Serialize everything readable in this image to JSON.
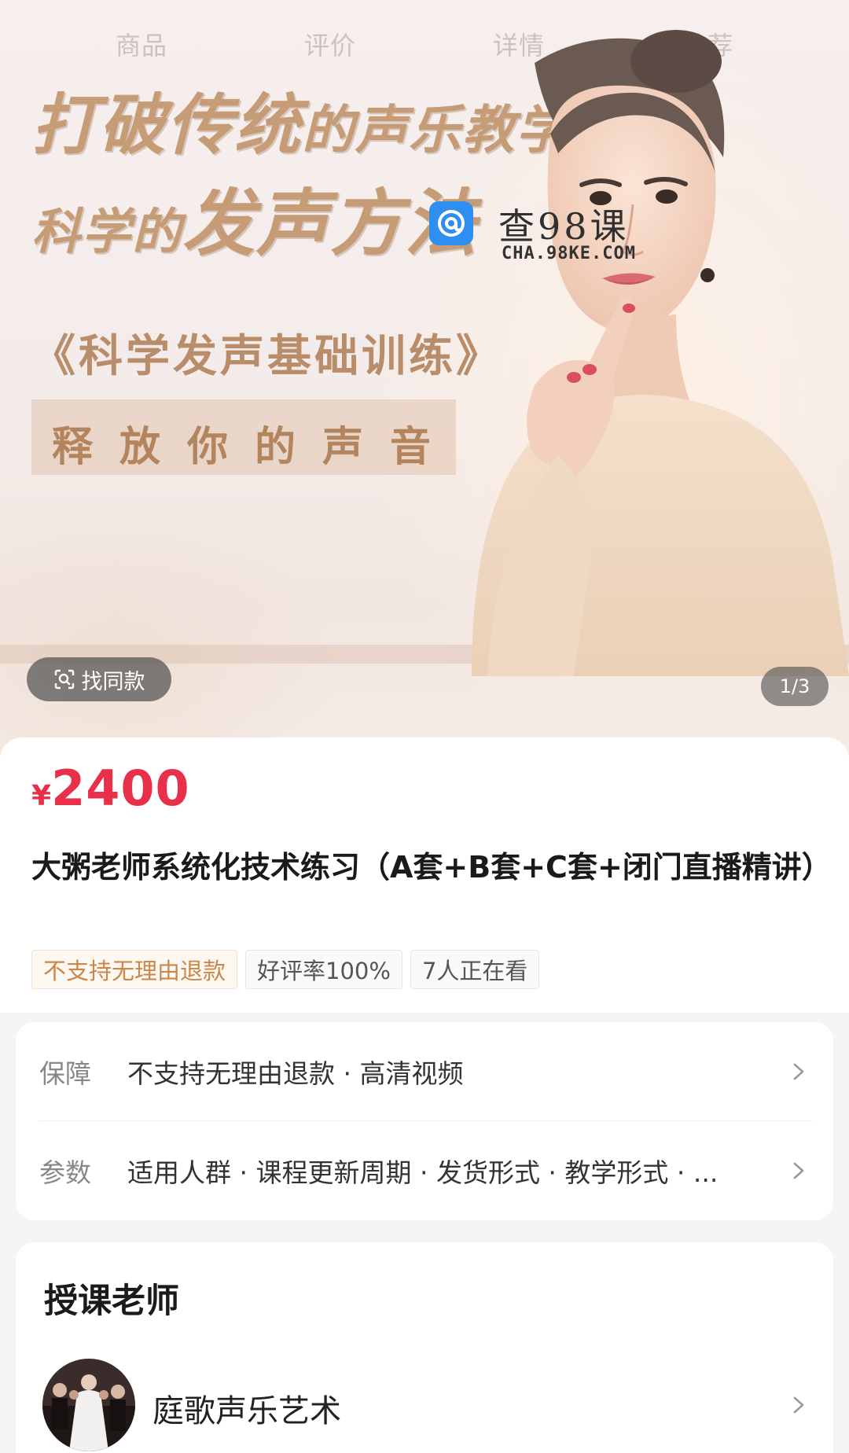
{
  "top_tabs": [
    "商品",
    "评价",
    "详情",
    "推荐"
  ],
  "banner": {
    "headline_line1": [
      {
        "text": "打破传统",
        "big": true
      },
      {
        "text": "的声乐教学",
        "big": false
      }
    ],
    "headline_line2": [
      {
        "text": "科学的",
        "big": false
      },
      {
        "text": "发声方法",
        "big": true
      }
    ],
    "subtitle": "《科学发声基础训练》",
    "slogan": "释放你的声音"
  },
  "watermark": {
    "title": "查98课",
    "url": "CHA.98KE.COM"
  },
  "find_similar_label": "找同款",
  "page_indicator": "1/3",
  "product": {
    "currency": "¥",
    "price": "2400",
    "title": "大粥老师系统化技术练习（A套+B套+C套+闭门直播精讲）",
    "tags": [
      {
        "text": "不支持无理由退款",
        "warn": true
      },
      {
        "text": "好评率100%",
        "warn": false
      },
      {
        "text": "7人正在看",
        "warn": false
      }
    ]
  },
  "service": {
    "guarantee_label": "保障",
    "guarantee_value": "不支持无理由退款 · 高清视频",
    "params_label": "参数",
    "params_value": "适用人群 · 课程更新周期 · 发货形式 · 教学形式 · ..."
  },
  "teacher": {
    "heading": "授课老师",
    "name": "庭歌声乐艺术"
  },
  "colors": {
    "price": "#e8304a",
    "warn_tag": "#c9874b",
    "banner_text": "#c69c76",
    "watermark_badge": "#2f8ff0"
  }
}
